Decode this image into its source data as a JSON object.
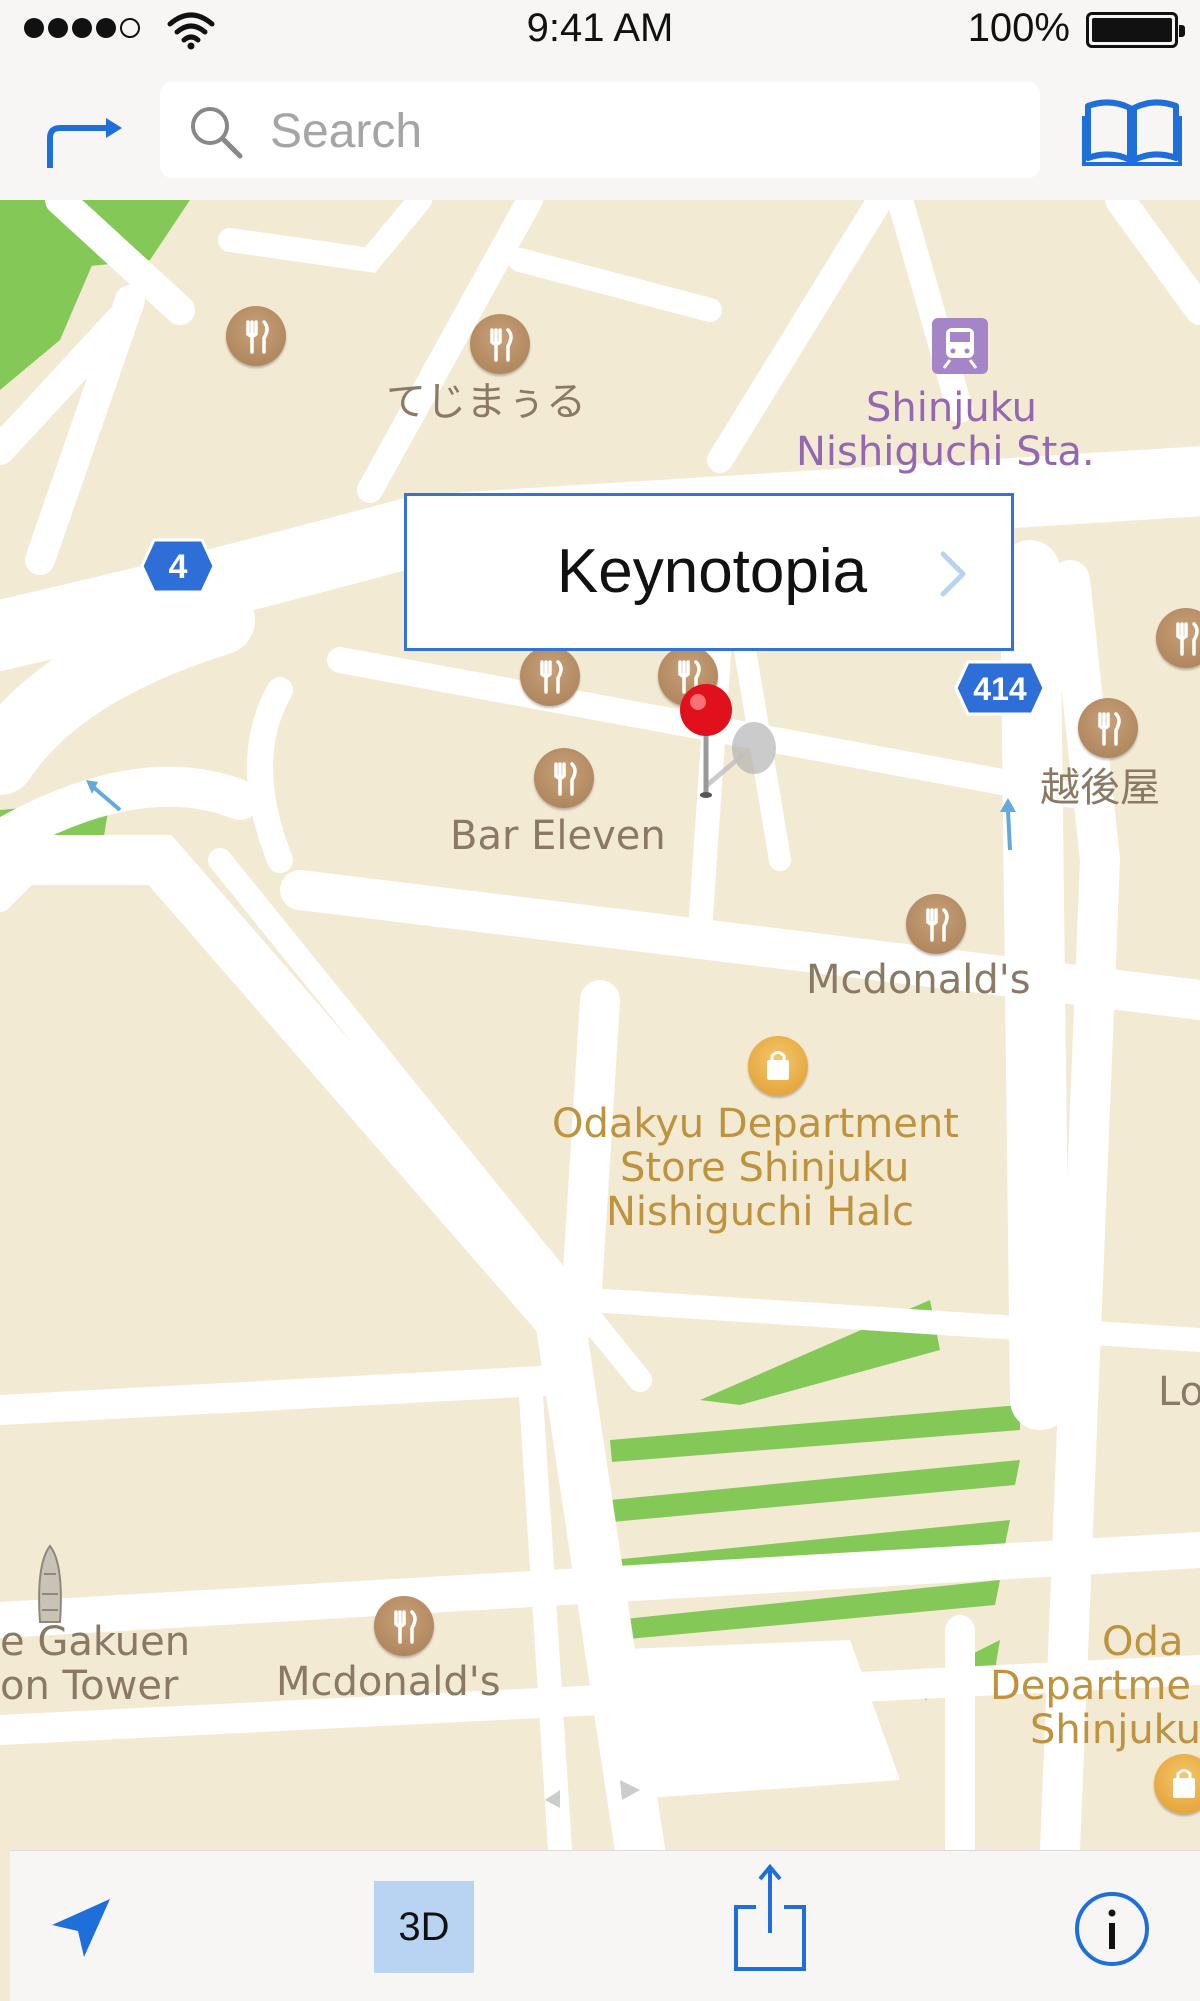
{
  "status_bar": {
    "time": "9:41 AM",
    "battery": "100%",
    "icons": [
      "signal-dots",
      "wifi-icon",
      "battery-icon"
    ]
  },
  "nav": {
    "search_placeholder": "Search",
    "icons": [
      "directions-arrow-icon",
      "search-icon",
      "bookmarks-book-icon"
    ]
  },
  "map": {
    "labels": {
      "tejimaaru": "てじまぅる",
      "station_line1": "Shinjuku",
      "station_line2": "Nishiguchi Sta.",
      "bar_eleven": "Bar Eleven",
      "echigoya": "越後屋",
      "mcdonalds_1": "Mcdonald's",
      "odakyu_line1": "Odakyu Department",
      "odakyu_line2": "Store Shinjuku",
      "odakyu_line3": "Nishiguchi Halc",
      "gakuen_line1": "e Gakuen",
      "gakuen_line2": "on Tower",
      "mcdonalds_2": "Mcdonald's",
      "lo": "Lo",
      "oda_line1": "Oda",
      "oda_line2": "Departme",
      "oda_line3": "Shinjuku"
    },
    "route_shields": [
      "4",
      "414"
    ],
    "colors": {
      "land": "#f3ead4",
      "road": "#ffffff",
      "park": "#7fcb4f",
      "pin": "#e0101c"
    }
  },
  "callout": {
    "title": "Keynotopia"
  },
  "toolbar": {
    "three_d_label": "3D",
    "accent": "#1e6fd9",
    "icons": [
      "location-arrow-icon",
      "share-icon",
      "info-icon"
    ]
  }
}
